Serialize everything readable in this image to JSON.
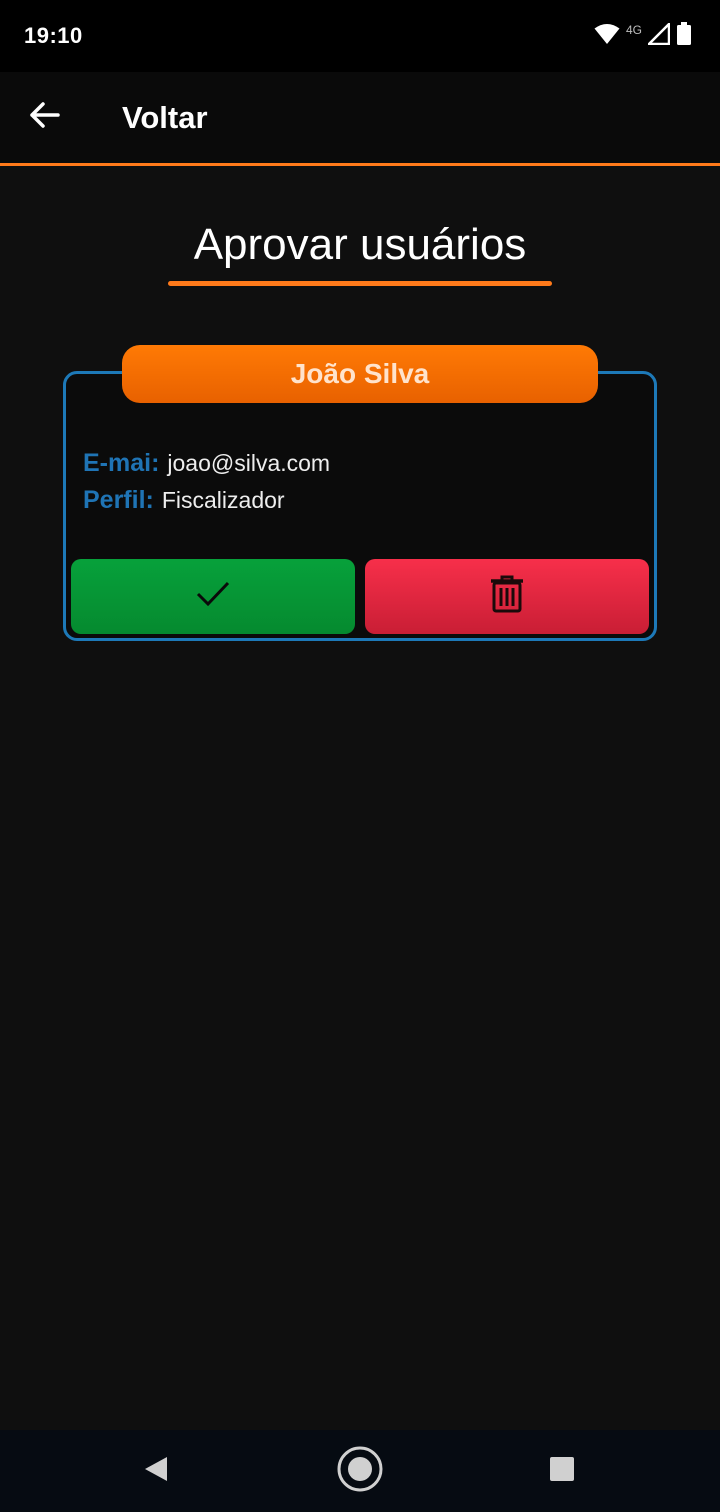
{
  "status_bar": {
    "time": "19:10",
    "network": "4G",
    "icons": [
      "wifi-icon",
      "signal-icon",
      "battery-icon"
    ]
  },
  "app_bar": {
    "back_icon": "arrow-left-icon",
    "title": "Voltar"
  },
  "page": {
    "title": "Aprovar usuários"
  },
  "user_card": {
    "name": "João Silva",
    "email_label": "E-mai:",
    "email_value": "joao@silva.com",
    "profile_label": "Perfil:",
    "profile_value": "Fiscalizador",
    "approve_icon": "check-icon",
    "delete_icon": "trash-icon"
  },
  "nav_bar": {
    "icons": [
      "back-triangle-icon",
      "home-circle-icon",
      "recents-square-icon"
    ]
  },
  "colors": {
    "accent": "#ff7a1a",
    "card_border": "#1d79b8",
    "label": "#1f74b5",
    "approve": "#07a13b",
    "delete": "#f72f4a"
  }
}
